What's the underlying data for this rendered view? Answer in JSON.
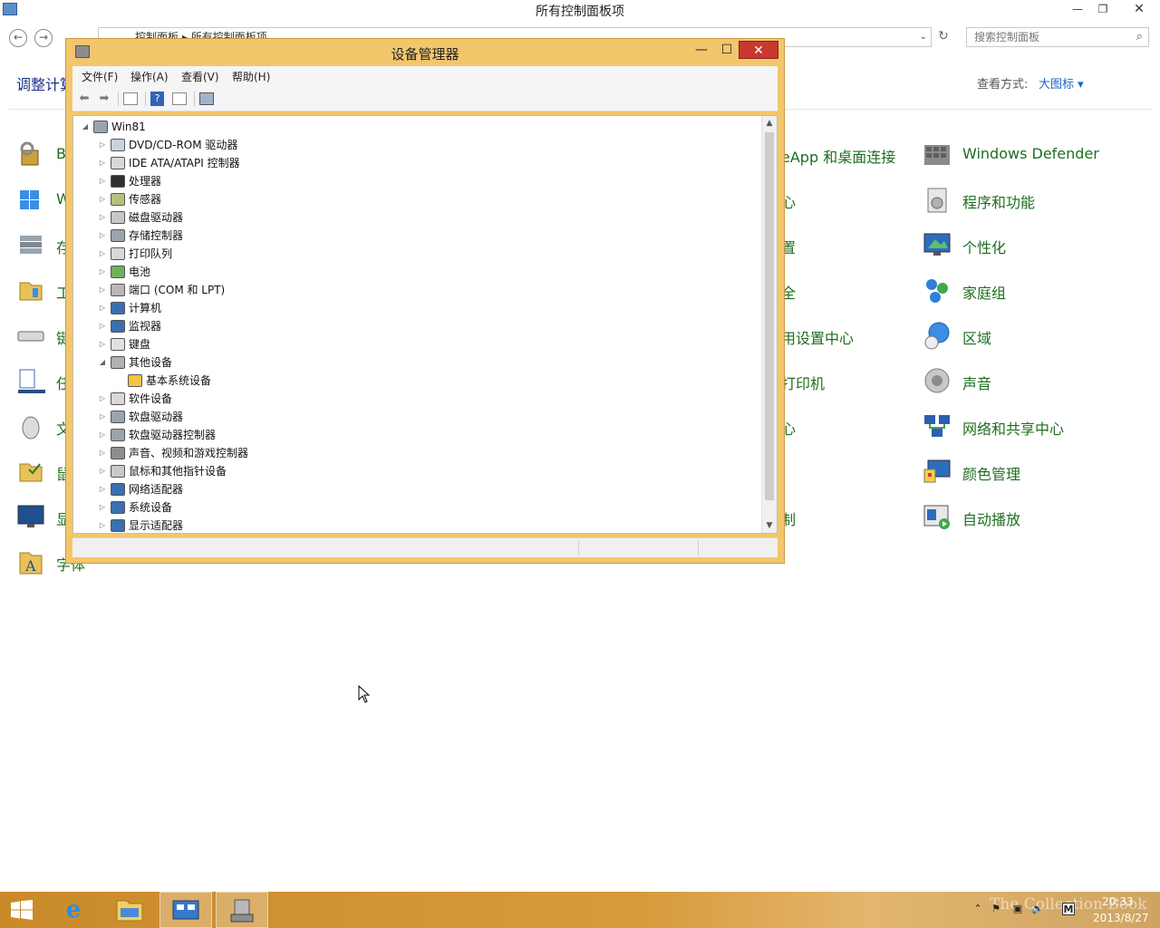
{
  "control_panel": {
    "title": "所有控制面板项",
    "address_path": [
      "控制面板",
      "所有控制面板项"
    ],
    "search_placeholder": "搜索控制面板",
    "heading_partial": "调整计算",
    "view_by_label": "查看方式:",
    "view_by_value": "大图标 ▾",
    "left_column_visible_fragments": [
      "B",
      "W",
      "存",
      "工",
      "键",
      "任",
      "鼠",
      "文",
      "显",
      "字体"
    ],
    "middle_column_visible_fragments": [
      "eApp 和桌面连接",
      "心",
      "置",
      "全",
      "用设置中心",
      "打印机",
      "心",
      "制"
    ],
    "right_column": [
      {
        "label": "Windows Defender",
        "icon": "windows-defender-icon"
      },
      {
        "label": "程序和功能",
        "icon": "programs-icon"
      },
      {
        "label": "个性化",
        "icon": "personalization-icon"
      },
      {
        "label": "家庭组",
        "icon": "homegroup-icon"
      },
      {
        "label": "区域",
        "icon": "region-icon"
      },
      {
        "label": "声音",
        "icon": "sound-icon"
      },
      {
        "label": "网络和共享中心",
        "icon": "network-icon"
      },
      {
        "label": "颜色管理",
        "icon": "color-management-icon"
      },
      {
        "label": "自动播放",
        "icon": "autoplay-icon"
      }
    ],
    "window_buttons": {
      "minimize": "—",
      "maximize": "❐",
      "close": "✕"
    }
  },
  "device_manager": {
    "title": "设备管理器",
    "window_buttons": {
      "minimize": "—",
      "maximize": "☐",
      "close": "✕"
    },
    "menus": [
      "文件(F)",
      "操作(A)",
      "查看(V)",
      "帮助(H)"
    ],
    "tree": [
      {
        "label": "Win81",
        "level": 0,
        "expander": "◢"
      },
      {
        "label": "DVD/CD-ROM 驱动器",
        "level": 1,
        "expander": "▷"
      },
      {
        "label": "IDE ATA/ATAPI 控制器",
        "level": 1,
        "expander": "▷"
      },
      {
        "label": "处理器",
        "level": 1,
        "expander": "▷"
      },
      {
        "label": "传感器",
        "level": 1,
        "expander": "▷"
      },
      {
        "label": "磁盘驱动器",
        "level": 1,
        "expander": "▷"
      },
      {
        "label": "存储控制器",
        "level": 1,
        "expander": "▷"
      },
      {
        "label": "打印队列",
        "level": 1,
        "expander": "▷"
      },
      {
        "label": "电池",
        "level": 1,
        "expander": "▷"
      },
      {
        "label": "端口 (COM 和 LPT)",
        "level": 1,
        "expander": "▷"
      },
      {
        "label": "计算机",
        "level": 1,
        "expander": "▷"
      },
      {
        "label": "监视器",
        "level": 1,
        "expander": "▷"
      },
      {
        "label": "键盘",
        "level": 1,
        "expander": "▷"
      },
      {
        "label": "其他设备",
        "level": 1,
        "expander": "◢"
      },
      {
        "label": "基本系统设备",
        "level": 2,
        "expander": ""
      },
      {
        "label": "软件设备",
        "level": 1,
        "expander": "▷"
      },
      {
        "label": "软盘驱动器",
        "level": 1,
        "expander": "▷"
      },
      {
        "label": "软盘驱动器控制器",
        "level": 1,
        "expander": "▷"
      },
      {
        "label": "声音、视频和游戏控制器",
        "level": 1,
        "expander": "▷"
      },
      {
        "label": "鼠标和其他指针设备",
        "level": 1,
        "expander": "▷"
      },
      {
        "label": "网络适配器",
        "level": 1,
        "expander": "▷"
      },
      {
        "label": "系统设备",
        "level": 1,
        "expander": "▷"
      },
      {
        "label": "显示适配器",
        "level": 1,
        "expander": "▷"
      }
    ]
  },
  "taskbar": {
    "time": "20:33",
    "date": "2013/8/27",
    "watermark": "The Collection Book",
    "tray_ime": "M"
  },
  "colors": {
    "dm_frame": "#f3c66c",
    "dm_close": "#c7392f",
    "cp_link_green": "#1e6e1e",
    "cp_heading_blue": "#1e3287",
    "taskbar": "#d89a3a"
  }
}
